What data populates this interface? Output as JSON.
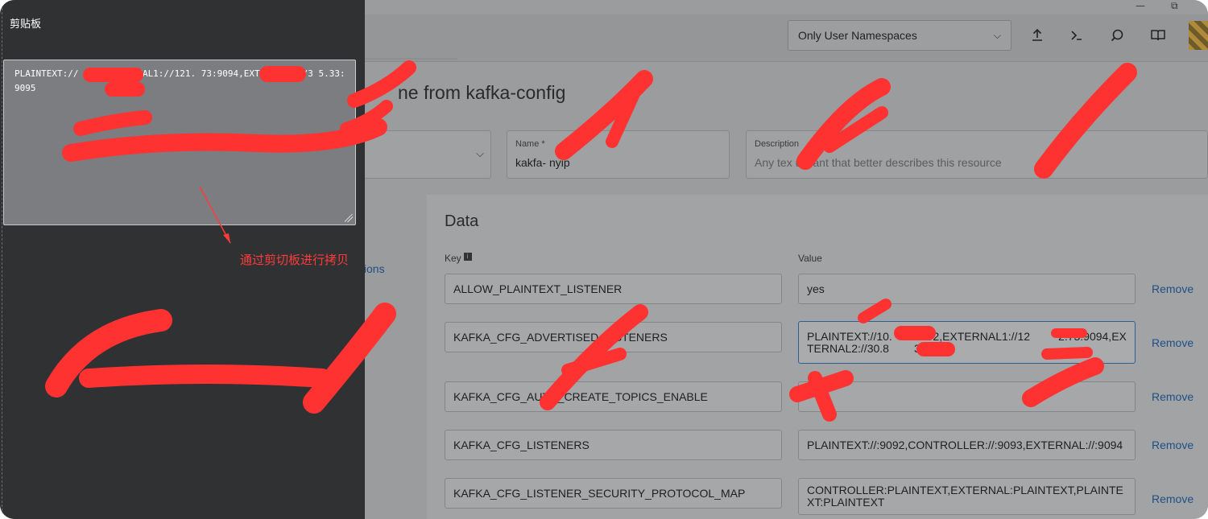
{
  "window": {
    "minimize": "—",
    "restore": "⧉"
  },
  "clipboard": {
    "title": "剪贴板",
    "content": "PLAINTEXT://          9092,EXTERNAL1://121.           73:9094,EXTERNAL2://3         5.33:9095",
    "annotation": "通过剪切板进行拷贝"
  },
  "topbar": {
    "namespace_filter": "Only User Namespaces",
    "icons": [
      "upload-icon",
      "terminal-icon",
      "search-icon",
      "book-icon"
    ]
  },
  "page": {
    "heading": "ne from kafka-config",
    "name_label": "Name *",
    "name_value": "kakfa-      nyip",
    "description_label": "Description",
    "description_placeholder": "Any tex    u want that better describes this resource",
    "left_link": "tions"
  },
  "data_section": {
    "title": "Data",
    "key_label": "Key",
    "value_label": "Value",
    "remove_label": "Remove",
    "rows": [
      {
        "key": "ALLOW_PLAINTEXT_LISTENER",
        "value": "yes"
      },
      {
        "key": "KAFKA_CFG_ADVERTISED_LISTENERS",
        "value": "PLAINTEXT://10.       9092,EXTERNAL1://12         2.73:9094,EXTERNAL2://30.8        3:9095"
      },
      {
        "key": "KAFKA_CFG_AUTO_CREATE_TOPICS_ENABLE",
        "value": ""
      },
      {
        "key": "KAFKA_CFG_LISTENERS",
        "value": "PLAINTEXT://:9092,CONTROLLER://:9093,EXTERNAL://:9094"
      },
      {
        "key": "KAFKA_CFG_LISTENER_SECURITY_PROTOCOL_MAP",
        "value": "CONTROLLER:PLAINTEXT,EXTERNAL:PLAINTEXT,PLAINTEXT:PLAINTEXT"
      }
    ]
  },
  "colors": {
    "redaction": "#ff3232",
    "link": "#1f4f86",
    "overlay_panel": "#303133"
  }
}
